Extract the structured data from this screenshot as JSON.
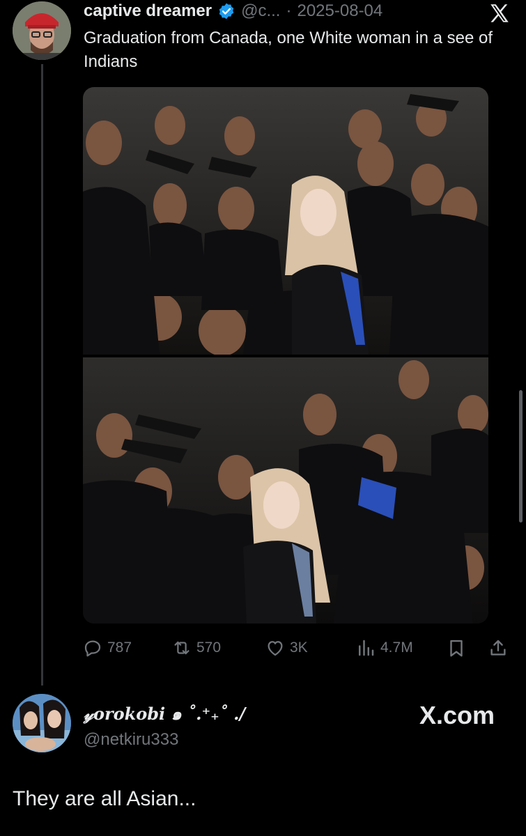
{
  "post": {
    "author_name": "captive dreamer",
    "handle": "@c...",
    "separator": "·",
    "date": "2025-08-04",
    "text": "Graduation from Canada, one White woman in a see of Indians",
    "stats": {
      "replies": "787",
      "reposts": "570",
      "likes": "3K",
      "views": "4.7M"
    }
  },
  "reply": {
    "author_name": "𝓎orokobi ๑ ˚.⁺₊˚ ./",
    "handle": "@netkiru333",
    "text": "They are all Asian..."
  },
  "watermark": "X.com",
  "colors": {
    "background": "#000000",
    "text": "#e7e9ea",
    "muted": "#71767b",
    "verified": "#1d9bf0"
  },
  "icons": [
    "verified-badge-icon",
    "x-logo-icon",
    "reply-icon",
    "repost-icon",
    "like-icon",
    "views-icon",
    "bookmark-icon",
    "share-icon"
  ]
}
